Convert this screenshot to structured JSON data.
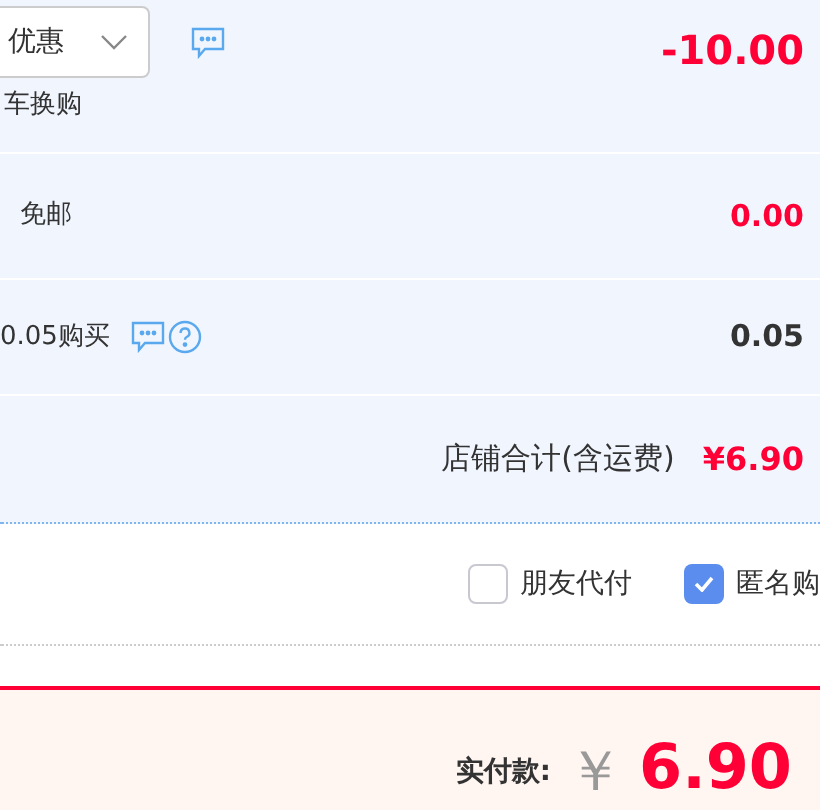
{
  "discount_row": {
    "select_value": "优惠",
    "note": "车换购",
    "amount": "-10.00"
  },
  "shipping_row": {
    "label": "免邮",
    "amount": "0.00"
  },
  "extra_row": {
    "label": "0.05购买",
    "amount": "0.05"
  },
  "shop_total": {
    "label": "店铺合计(含运费)",
    "amount": "¥6.90"
  },
  "options": [
    {
      "label": "朋友代付",
      "checked": false
    },
    {
      "label": "匿名购",
      "checked": true
    }
  ],
  "payment": {
    "label": "实付款:",
    "currency": "￥",
    "amount": "6.90"
  }
}
